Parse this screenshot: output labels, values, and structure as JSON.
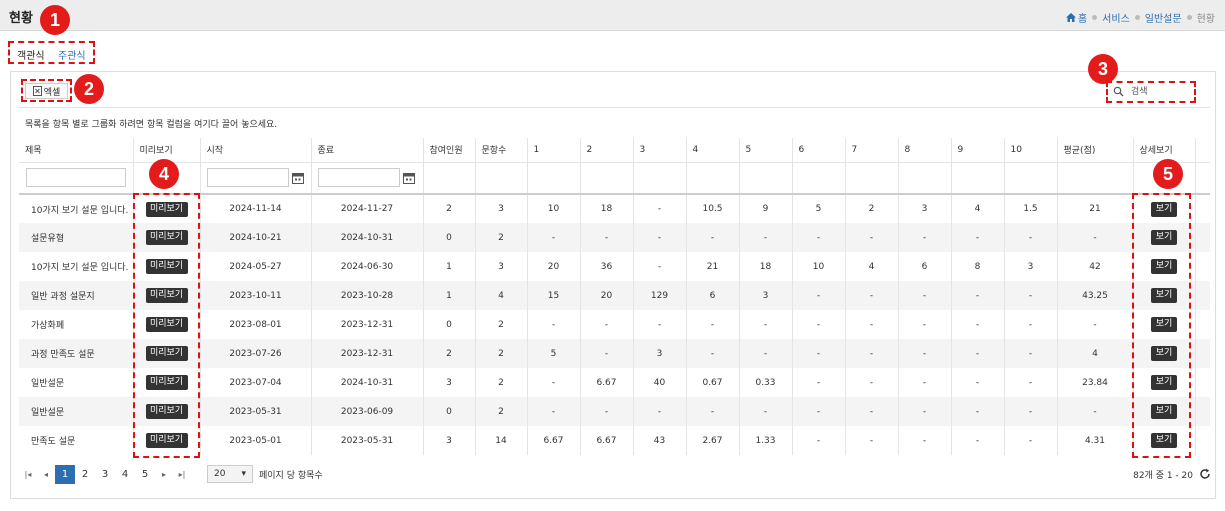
{
  "page": {
    "title": "현황"
  },
  "breadcrumb": [
    {
      "label": "홈"
    },
    {
      "label": "서비스"
    },
    {
      "label": "일반설문"
    },
    {
      "label": "현황"
    }
  ],
  "tabs": [
    {
      "label": "객관식"
    },
    {
      "label": "주관식"
    }
  ],
  "toolbar": {
    "excel_label": "엑셀",
    "search_placeholder": "검색"
  },
  "group_hint": "목록을 항목 별로 그룹화 하려면 항목 컬럼을 여기다 끌어 놓으세요.",
  "table": {
    "columns": [
      "제목",
      "미리보기",
      "시작",
      "종료",
      "참여인원",
      "문항수",
      "1",
      "2",
      "3",
      "4",
      "5",
      "6",
      "7",
      "8",
      "9",
      "10",
      "평균(점)",
      "상세보기"
    ],
    "preview_label": "미리보기",
    "detail_label": "보기",
    "rows": [
      [
        "10가지 보기 설문 입니다.",
        "2024-11-14",
        "2024-11-27",
        "2",
        "3",
        "10",
        "18",
        "-",
        "10.5",
        "9",
        "5",
        "2",
        "3",
        "4",
        "1.5",
        "21"
      ],
      [
        "설문유형",
        "2024-10-21",
        "2024-10-31",
        "0",
        "2",
        "-",
        "-",
        "-",
        "-",
        "-",
        "-",
        "-",
        "-",
        "-",
        "-",
        "-"
      ],
      [
        "10가지 보기 설문 입니다.",
        "2024-05-27",
        "2024-06-30",
        "1",
        "3",
        "20",
        "36",
        "-",
        "21",
        "18",
        "10",
        "4",
        "6",
        "8",
        "3",
        "42"
      ],
      [
        "일반 과정 설문지",
        "2023-10-11",
        "2023-10-28",
        "1",
        "4",
        "15",
        "20",
        "129",
        "6",
        "3",
        "-",
        "-",
        "-",
        "-",
        "-",
        "43.25"
      ],
      [
        "가상화폐",
        "2023-08-01",
        "2023-12-31",
        "0",
        "2",
        "-",
        "-",
        "-",
        "-",
        "-",
        "-",
        "-",
        "-",
        "-",
        "-",
        "-"
      ],
      [
        "과정 만족도 설문",
        "2023-07-26",
        "2023-12-31",
        "2",
        "2",
        "5",
        "-",
        "3",
        "-",
        "-",
        "-",
        "-",
        "-",
        "-",
        "-",
        "4"
      ],
      [
        "일반설문",
        "2023-07-04",
        "2024-10-31",
        "3",
        "2",
        "-",
        "6.67",
        "40",
        "0.67",
        "0.33",
        "-",
        "-",
        "-",
        "-",
        "-",
        "23.84"
      ],
      [
        "일반설문",
        "2023-05-31",
        "2023-06-09",
        "0",
        "2",
        "-",
        "-",
        "-",
        "-",
        "-",
        "-",
        "-",
        "-",
        "-",
        "-",
        "-"
      ],
      [
        "만족도 설문",
        "2023-05-01",
        "2023-05-31",
        "3",
        "14",
        "6.67",
        "6.67",
        "43",
        "2.67",
        "1.33",
        "-",
        "-",
        "-",
        "-",
        "-",
        "4.31"
      ]
    ]
  },
  "pager": {
    "pages": [
      "1",
      "2",
      "3",
      "4",
      "5"
    ],
    "current_page": "1",
    "page_size": "20",
    "page_size_label": "페이지 당 항목수",
    "info": "82개 중 1 - 20"
  },
  "annotations": [
    "1",
    "2",
    "3",
    "4",
    "5"
  ],
  "colors": {
    "accent": "#2c6fb1",
    "annotation": "#e31b1b",
    "button_dark": "#333333"
  },
  "icons": {
    "home": "home-icon",
    "excel": "excel-icon",
    "search": "search-icon",
    "calendar": "calendar-icon",
    "refresh": "refresh-icon"
  }
}
